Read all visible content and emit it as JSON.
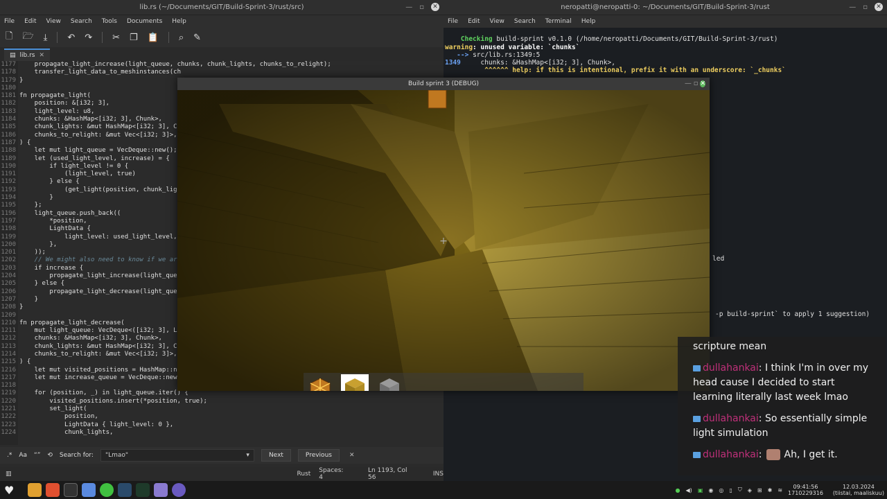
{
  "editor": {
    "title": "lib.rs (~/Documents/GIT/Build-Sprint-3/rust/src)",
    "menu": [
      "File",
      "Edit",
      "View",
      "Search",
      "Tools",
      "Documents",
      "Help"
    ],
    "tab_label": "lib.rs",
    "line_numbers": [
      "1177",
      "1178",
      "1179",
      "1180",
      "1181",
      "1182",
      "1183",
      "1184",
      "1185",
      "1186",
      "1187",
      "1188",
      "1189",
      "1190",
      "1191",
      "1192",
      "1193",
      "1194",
      "1195",
      "1196",
      "1197",
      "1198",
      "1199",
      "1200",
      "1201",
      "1202",
      "1203",
      "1204",
      "1205",
      "1206",
      "1207",
      "1208",
      "1209",
      "1210",
      "1211",
      "1212",
      "1213",
      "1214",
      "1215",
      "1216",
      "1217",
      "1218",
      "1219",
      "1220",
      "1221",
      "1222",
      "1223",
      "1224"
    ],
    "code_lines": [
      "    propagate_light_increase(light_queue, chunks, chunk_lights, chunks_to_relight);",
      "    transfer_light_data_to_meshinstances(ch",
      "}",
      "",
      "fn propagate_light(",
      "    position: &[i32; 3],",
      "    light_level: u8,",
      "    chunks: &HashMap<[i32; 3], Chunk>,",
      "    chunk_lights: &mut HashMap<[i32; 3], Ch",
      "    chunks_to_relight: &mut Vec<[i32; 3]>,",
      ") {",
      "    let mut light_queue = VecDeque::new();",
      "    let (used_light_level, increase) = {",
      "        if light_level != 0 {",
      "            (light_level, true)",
      "        } else {",
      "            (get_light(position, chunk_ligh",
      "        }",
      "    };",
      "    light_queue.push_back((",
      "        *position,",
      "        LightData {",
      "            light_level: used_light_level,",
      "        },",
      "    ));",
      "    // We might also need to know if we are",
      "    if increase {",
      "        propagate_light_increase(light_queu",
      "    } else {",
      "        propagate_light_decrease(light_queu",
      "    }",
      "}",
      "",
      "fn propagate_light_decrease(",
      "    mut light_queue: VecDeque<([i32; 3], Li",
      "    chunks: &HashMap<[i32; 3], Chunk>,",
      "    chunk_lights: &mut HashMap<[i32; 3], Ch",
      "    chunks_to_relight: &mut Vec<[i32; 3]>,",
      ") {",
      "    let mut visited_positions = HashMap::ne",
      "    let mut increase_queue = VecDeque::new(",
      "",
      "    for (position, _) in light_queue.iter() {",
      "        visited_positions.insert(*position, true);",
      "        set_light(",
      "            position,",
      "            LightData { light_level: 0 },",
      "            chunk_lights,"
    ],
    "search_label": "Search for:",
    "search_value": "\"Lmao\"",
    "next_label": "Next",
    "previous_label": "Previous",
    "status_lang": "Rust",
    "status_spaces": "Spaces: 4",
    "status_position": "Ln 1193, Col 56",
    "status_mode": "INS"
  },
  "terminal": {
    "title": "neropatti@neropatti-0: ~/Documents/GIT/Build-Sprint-3/rust",
    "menu": [
      "File",
      "Edit",
      "View",
      "Search",
      "Terminal",
      "Help"
    ],
    "line1_kw": "Checking",
    "line1_rest": " build-sprint v0.1.0 (/home/neropatti/Documents/GIT/Build-Sprint-3/rust)",
    "line2_kw": "warning",
    "line2_rest": ": unused variable: `chunks`",
    "line3_arrow": "-->",
    "line3_rest": " src/lib.rs:1349:5",
    "line4_no": "1349",
    "line4_rest": "     chunks: &HashMap<[i32; 3], Chunk>,",
    "line5": "^^^^^^ help: if this is intentional, prefix it with an underscore: `_chunks`",
    "line6": "led",
    "line7": "-p build-sprint` to apply 1 suggestion)"
  },
  "game": {
    "title": "Build sprint 3 (DEBUG)",
    "hotbar_selected_index": 1
  },
  "chat": {
    "msg0": "scripture mean",
    "msg1_user": "dullahankai",
    "msg1_text": ": I think I'm in over my head cause I decided to start learning literally last week lmao",
    "msg2_user": "dullahankai",
    "msg2_text": ": So essentially simple light simulation",
    "msg3_user": "dullahankai",
    "msg3_text": ":",
    "msg3_tail": "Ah, I get it."
  },
  "taskbar": {
    "time": "09:41:56",
    "unix": "1710229316",
    "date": "12.03.2024",
    "day": "(tiistai, maaliskuu)"
  },
  "colors": {
    "accent": "#4a90d9",
    "chat_user": "#c0307a",
    "terminal_green": "#5fd35f"
  }
}
